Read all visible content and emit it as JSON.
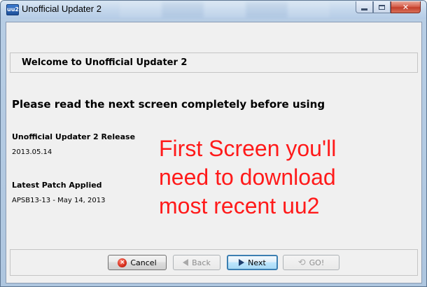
{
  "window": {
    "title": "Unofficial Updater 2",
    "icon_text": "uu2"
  },
  "header": {
    "title": "Welcome to Unofficial Updater 2"
  },
  "main": {
    "instruction": "Please read the next screen completely before using",
    "release_label": "Unofficial Updater 2 Release",
    "release_value": "2013.05.14",
    "patch_label": "Latest Patch Applied",
    "patch_value": "APSB13-13 - May 14, 2013"
  },
  "annotation": {
    "text": "First Screen you'll\nneed to download\nmost recent uu2",
    "color": "#ff1a1a"
  },
  "buttons": {
    "cancel": "Cancel",
    "back": "Back",
    "next": "Next",
    "go": "GO!"
  },
  "icons": {
    "app": "uu2-app-icon",
    "cancel": "cancel-icon",
    "back": "back-arrow-icon",
    "next": "next-arrow-icon",
    "go": "go-refresh-icon"
  }
}
